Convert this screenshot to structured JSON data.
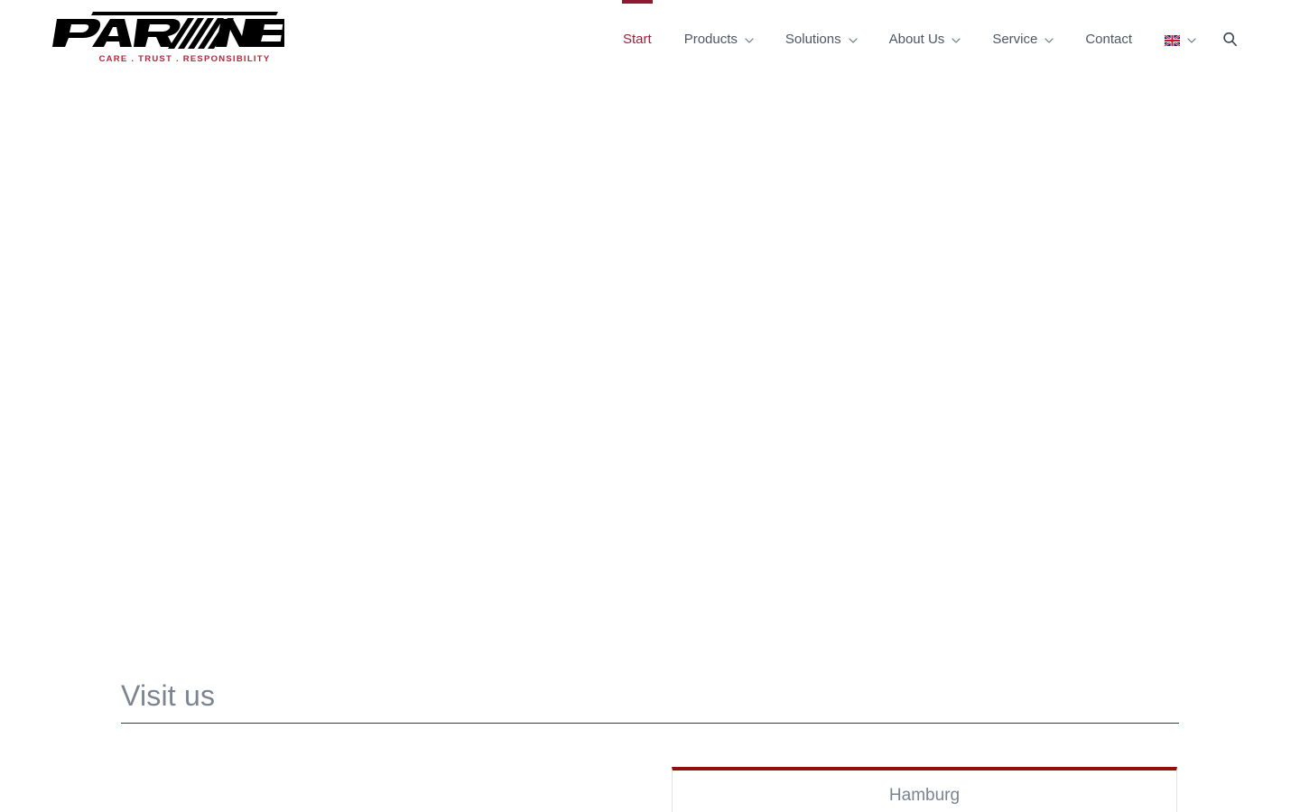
{
  "brand": {
    "logo_text": "PARTNER",
    "tagline": "CARE . TRUST . RESPONSIBILITY",
    "logo_icon": "partner-wordmark-logo",
    "logo_color": "#000000",
    "tagline_color": "#AE2A3C"
  },
  "colors": {
    "accent_red": "#A01F3C",
    "rule_red": "#7B1B33",
    "card_top_red": "#8E1008",
    "nav_text": "#4C5763",
    "heading_gray": "#7B8592"
  },
  "nav": {
    "items": [
      {
        "label": "Start",
        "has_dropdown": false,
        "active": true,
        "icon": ""
      },
      {
        "label": "Products",
        "has_dropdown": true,
        "active": false,
        "icon": "chevron-down-icon"
      },
      {
        "label": "Solutions",
        "has_dropdown": true,
        "active": false,
        "icon": "chevron-down-icon"
      },
      {
        "label": "About Us",
        "has_dropdown": true,
        "active": false,
        "icon": "chevron-down-icon"
      },
      {
        "label": "Service",
        "has_dropdown": true,
        "active": false,
        "icon": "chevron-down-icon"
      },
      {
        "label": "Contact",
        "has_dropdown": false,
        "active": false,
        "icon": ""
      }
    ],
    "language": {
      "current": "English",
      "flag_icon": "uk-flag-icon",
      "has_dropdown": true
    },
    "search": {
      "icon": "search-icon",
      "label": "Search"
    }
  },
  "hero": {
    "content": ""
  },
  "visit": {
    "heading": "Visit us",
    "locations": [
      {
        "name": "Hamburg"
      }
    ]
  }
}
